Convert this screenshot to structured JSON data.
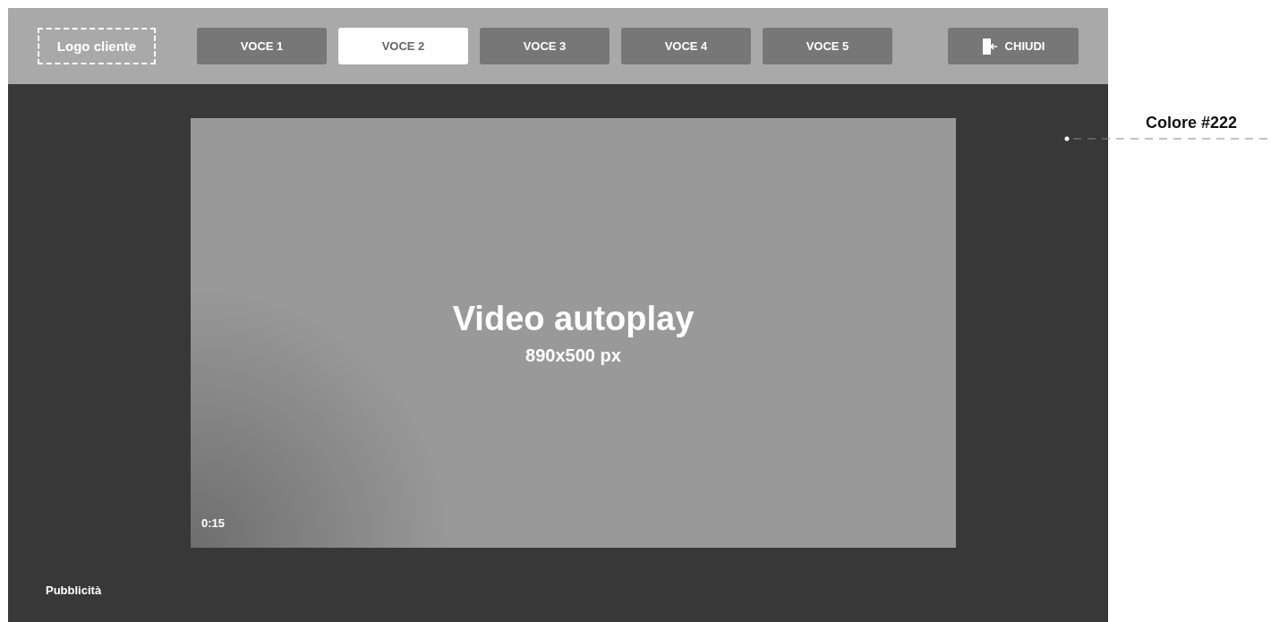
{
  "header": {
    "logo": "Logo cliente",
    "tabs": [
      {
        "label": "VOCE 1",
        "selected": false
      },
      {
        "label": "VOCE 2",
        "selected": true
      },
      {
        "label": "VOCE 3",
        "selected": false
      },
      {
        "label": "VOCE 4",
        "selected": false
      },
      {
        "label": "VOCE 5",
        "selected": false
      }
    ],
    "close_button": "CHIUDI"
  },
  "video": {
    "title": "Video autoplay",
    "size": "890x500 px",
    "time": "0:15"
  },
  "footer_label": "Pubblicità",
  "annotation": "Colore #222"
}
